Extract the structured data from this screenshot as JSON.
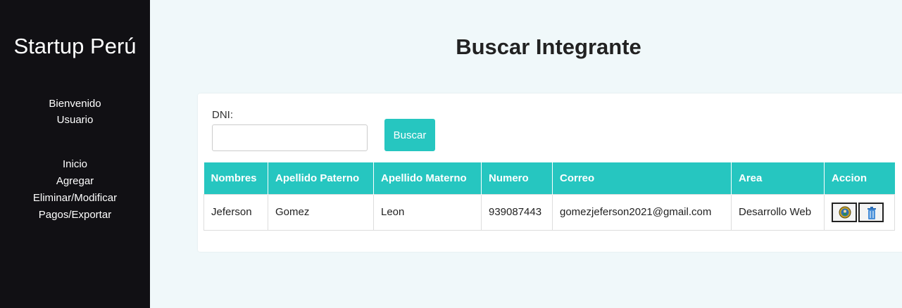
{
  "sidebar": {
    "brand": "Startup Perú",
    "welcome_line1": "Bienvenido",
    "welcome_line2": "Usuario",
    "nav": [
      "Inicio",
      "Agregar",
      "Eliminar/Modificar",
      "Pagos/Exportar"
    ]
  },
  "main": {
    "title": "Buscar Integrante",
    "form": {
      "dni_label": "DNI:",
      "dni_value": "",
      "search_label": "Buscar"
    },
    "table": {
      "headers": [
        "Nombres",
        "Apellido Paterno",
        "Apellido Materno",
        "Numero",
        "Correo",
        "Area",
        "Accion"
      ],
      "rows": [
        [
          "Jeferson",
          "Gomez",
          "Leon",
          "939087443",
          "gomezjeferson2021@gmail.com",
          "Desarrollo Web"
        ]
      ],
      "actions": [
        {
          "icon": "edit-icon"
        },
        {
          "icon": "delete-icon"
        }
      ]
    }
  },
  "colors": {
    "sidebar_bg": "#111014",
    "accent": "#26c6c0",
    "page_bg": "#f0f8fa"
  }
}
